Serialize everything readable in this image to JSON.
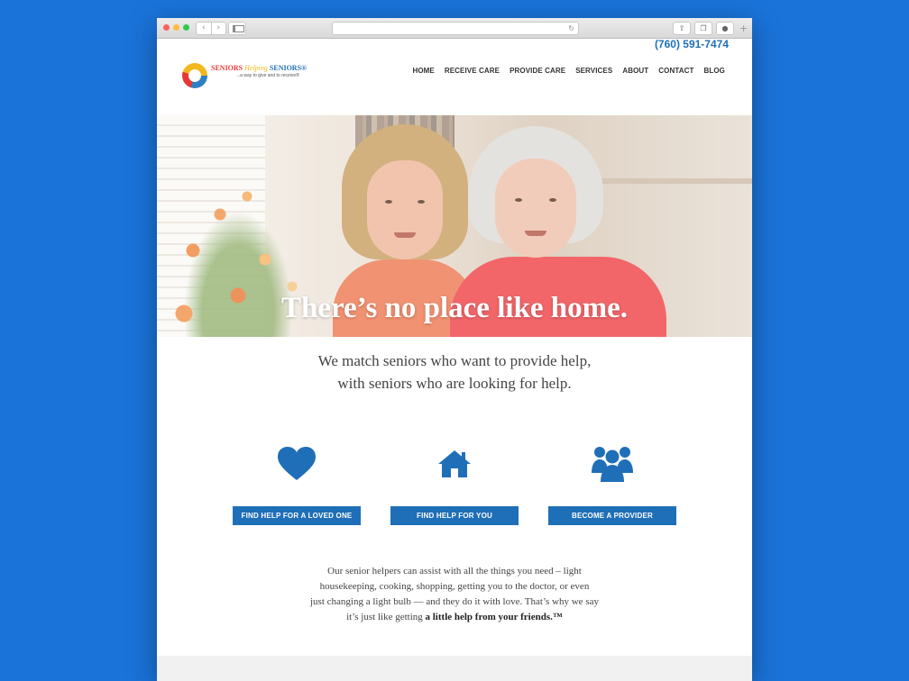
{
  "browser": {
    "back_glyph": "‹",
    "forward_glyph": "›",
    "reload_glyph": "↻",
    "share_glyph": "⇧",
    "tabs_glyph": "❐",
    "download_glyph": "●",
    "new_tab_glyph": "+"
  },
  "header": {
    "phone": "(760) 591-7474",
    "logo": {
      "word1": "SENIORS",
      "word2": "Helping",
      "word3": "SENIORS®",
      "tagline": "...a way to give and to receive®"
    },
    "nav": [
      "HOME",
      "RECEIVE CARE",
      "PROVIDE CARE",
      "SERVICES",
      "ABOUT",
      "CONTACT",
      "BLOG"
    ]
  },
  "hero": {
    "headline": "There’s no place like home."
  },
  "intro": {
    "line1": "We match seniors who want to provide help,",
    "line2": "with seniors who are looking for help."
  },
  "features": [
    {
      "icon": "heart-icon",
      "button": "FIND HELP FOR A LOVED ONE"
    },
    {
      "icon": "house-icon",
      "button": "FIND HELP FOR YOU"
    },
    {
      "icon": "group-icon",
      "button": "BECOME A PROVIDER"
    }
  ],
  "body": {
    "line1": "Our senior helpers can assist with all the things you need – light",
    "line2": "housekeeping, cooking, shopping, getting you to the doctor, or even",
    "line3": "just changing a light bulb — and they do it with love. That’s why we say",
    "line4_prefix": "it’s just like getting ",
    "line4_bold": "a little help from your friends.™"
  },
  "colors": {
    "brand_blue": "#1f6fb8",
    "background_blue": "#1a73d9"
  }
}
